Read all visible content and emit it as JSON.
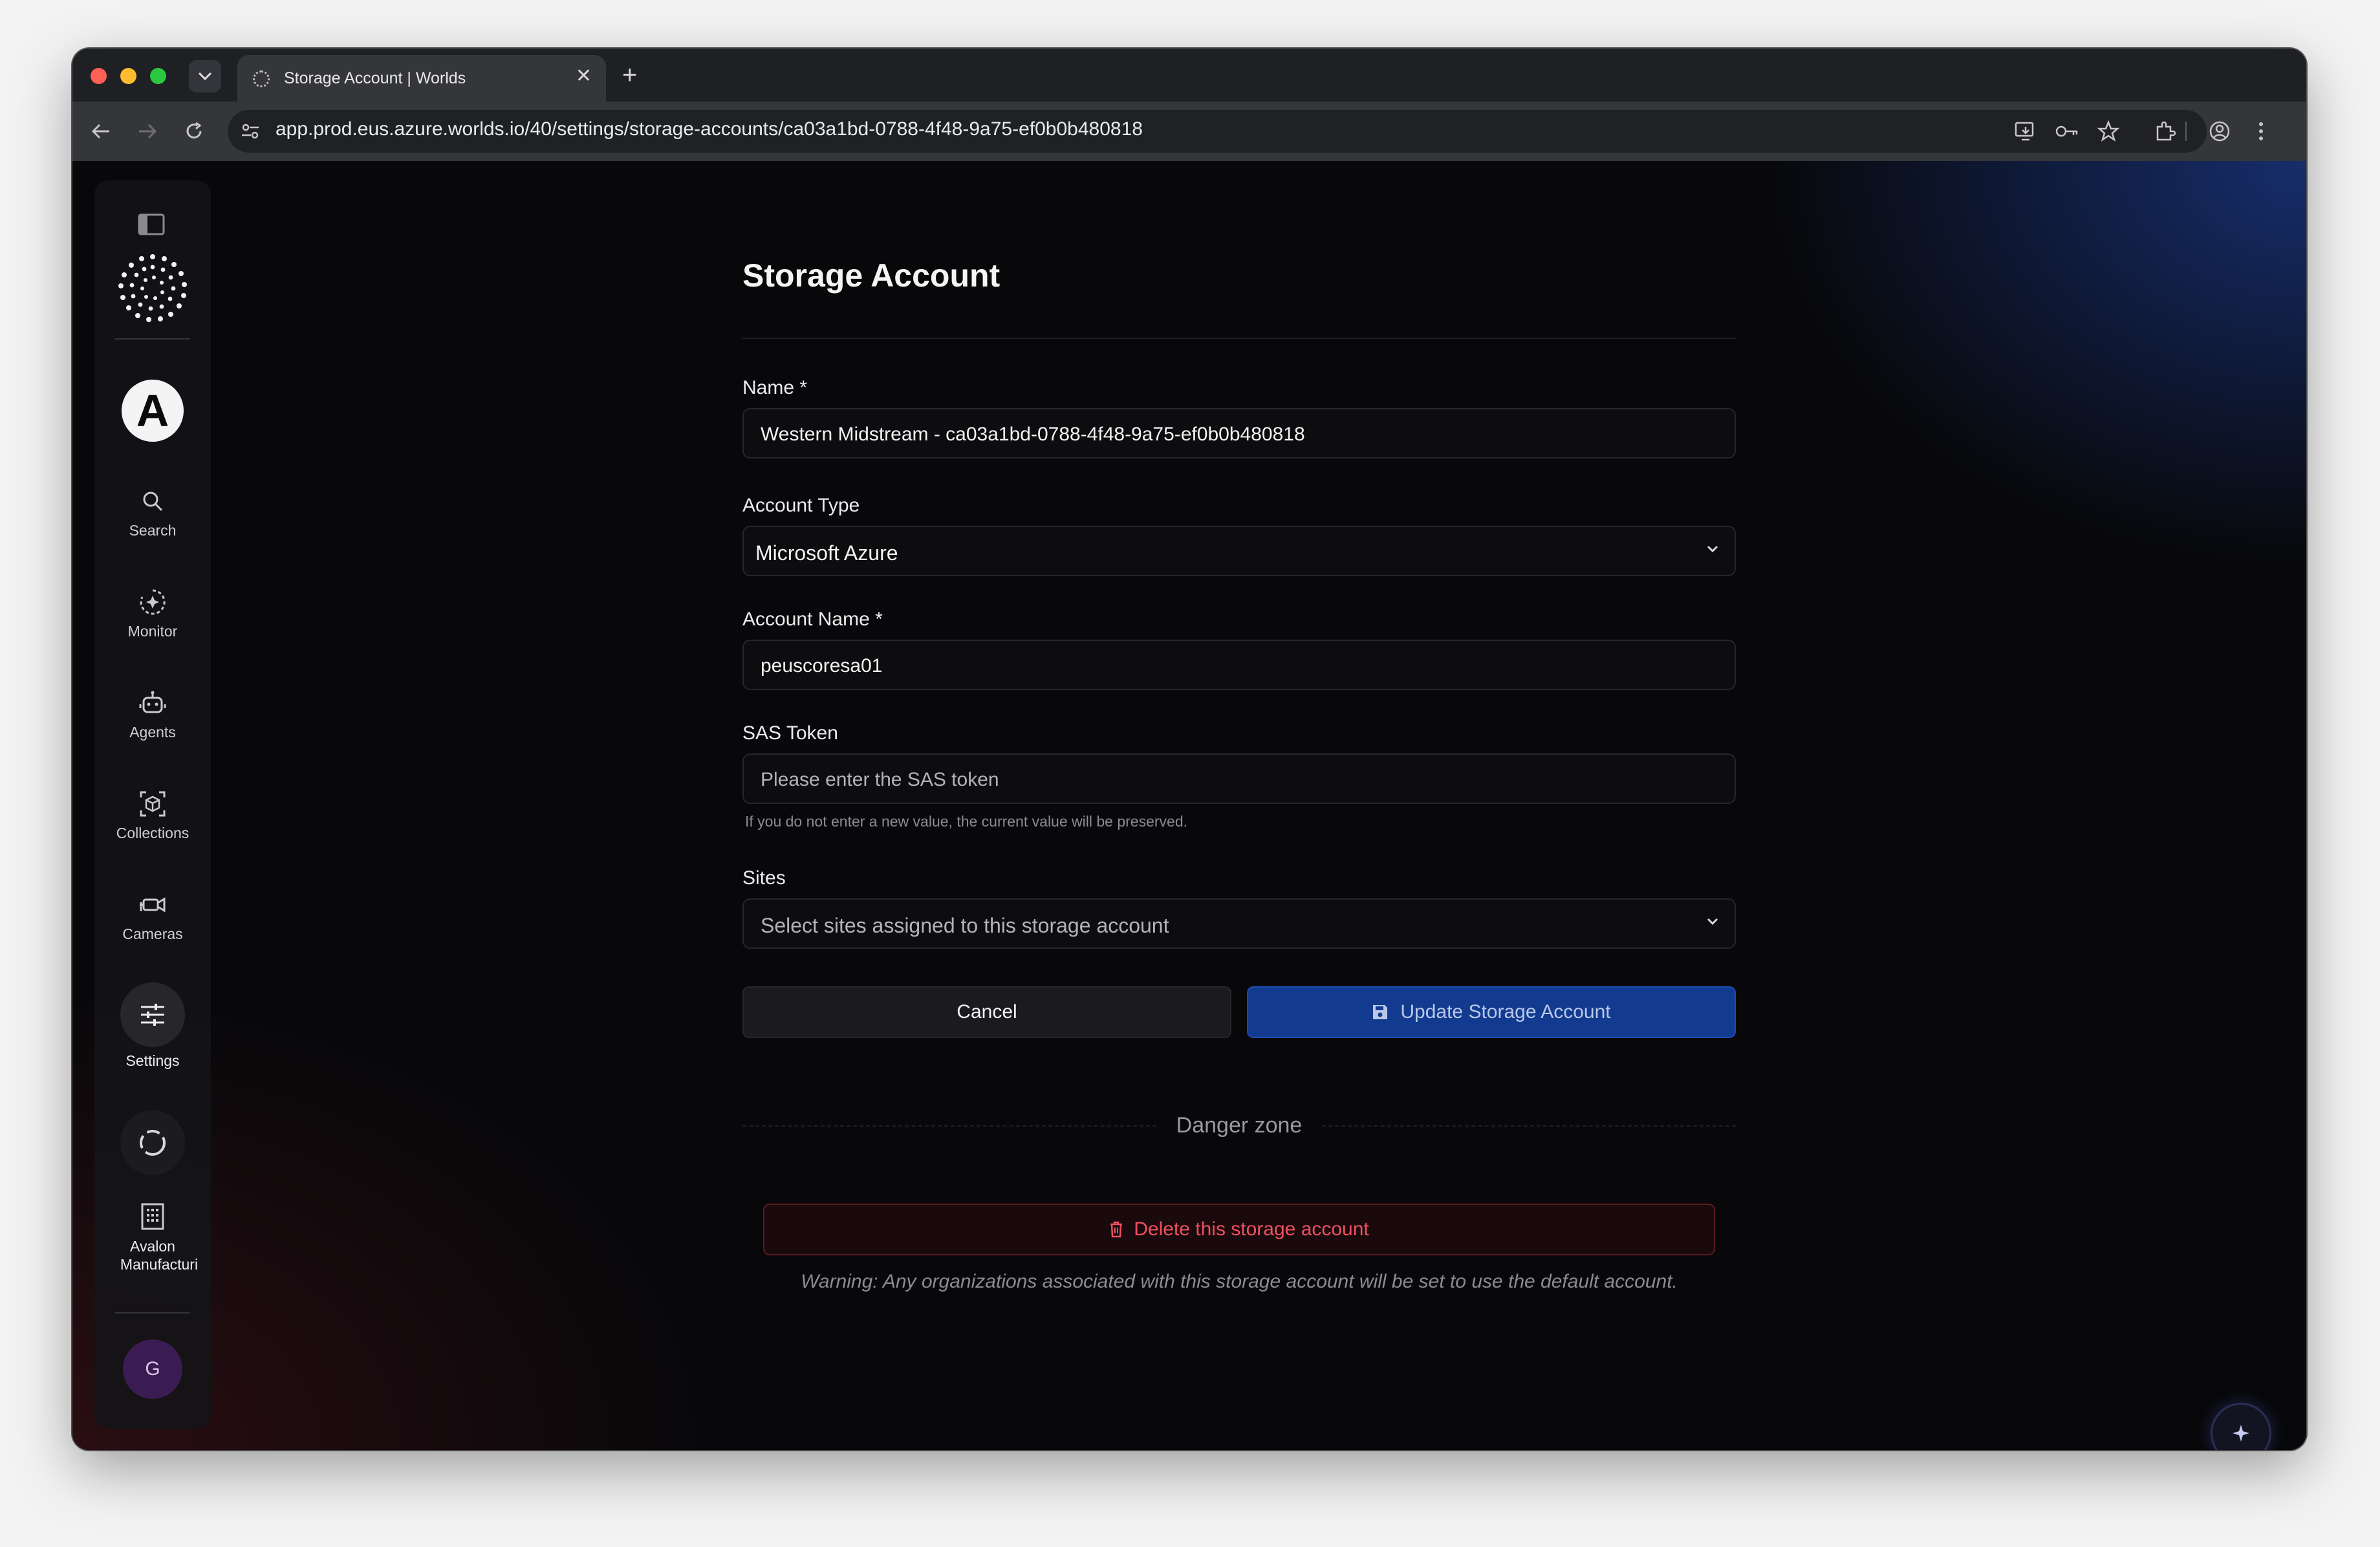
{
  "browser": {
    "tab_title": "Storage Account | Worlds",
    "url": "app.prod.eus.azure.worlds.io/40/settings/storage-accounts/ca03a1bd-0788-4f48-9a75-ef0b0b480818"
  },
  "sidebar": {
    "org_initial": "A",
    "items": [
      {
        "label": "Search",
        "icon": "search-icon"
      },
      {
        "label": "Monitor",
        "icon": "monitor-icon"
      },
      {
        "label": "Agents",
        "icon": "robot-icon"
      },
      {
        "label": "Collections",
        "icon": "cube-icon"
      },
      {
        "label": "Cameras",
        "icon": "camera-icon"
      },
      {
        "label": "Settings",
        "icon": "sliders-icon"
      }
    ],
    "org_label_line1": "Avalon",
    "org_label_line2": "Manufacturi",
    "avatar_initial": "G"
  },
  "form": {
    "title": "Storage Account",
    "name_label": "Name *",
    "name_value": "Western Midstream - ca03a1bd-0788-4f48-9a75-ef0b0b480818",
    "account_type_label": "Account Type",
    "account_type_value": "Microsoft Azure",
    "account_name_label": "Account Name *",
    "account_name_value": "peuscoresa01",
    "sas_label": "SAS Token",
    "sas_placeholder": "Please enter the SAS token",
    "sas_hint": "If you do not enter a new value, the current value will be preserved.",
    "sites_label": "Sites",
    "sites_placeholder": "Select sites assigned to this storage account",
    "cancel_label": "Cancel",
    "update_label": "Update Storage Account",
    "danger_zone_label": "Danger zone",
    "delete_label": "Delete this storage account",
    "warning_text": "Warning: Any organizations associated with this storage account will be set to use the default account."
  },
  "colors": {
    "primary": "#123a8e",
    "danger": "#f04f5e",
    "background": "#08080a"
  }
}
